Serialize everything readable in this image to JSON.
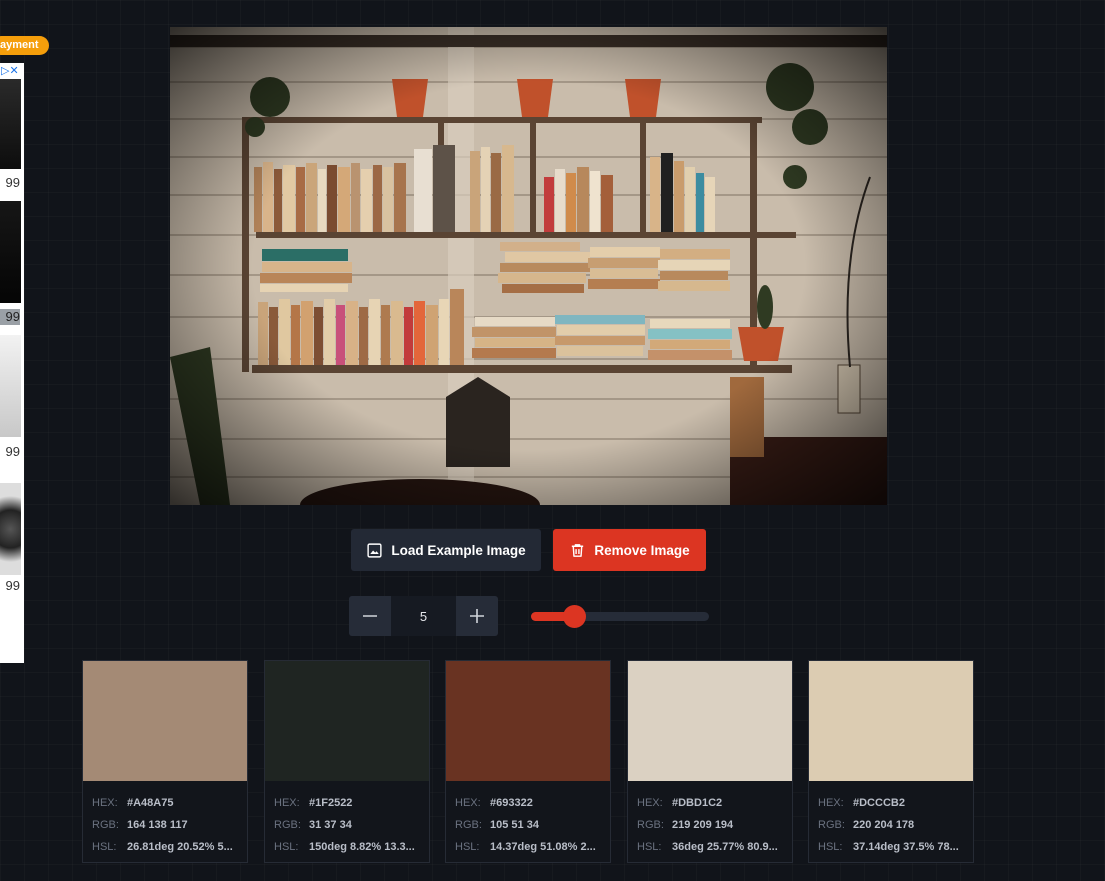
{
  "ad": {
    "badge": "ayment",
    "close_icon": "ad-choices-close",
    "prices": [
      "99",
      "99",
      "99",
      "99"
    ]
  },
  "image": {
    "description_icon": "bookshelf-photo"
  },
  "buttons": {
    "load_label": "Load Example Image",
    "remove_label": "Remove Image"
  },
  "palette_controls": {
    "count": "5",
    "slider_fraction": 0.24
  },
  "labels": {
    "hex": "HEX:",
    "rgb": "RGB:",
    "hsl": "HSL:"
  },
  "palette": [
    {
      "color": "#A48A75",
      "hex": "#A48A75",
      "rgb": "164 138 117",
      "hsl": "26.81deg 20.52% 5..."
    },
    {
      "color": "#1F2522",
      "hex": "#1F2522",
      "rgb": "31 37 34",
      "hsl": "150deg 8.82% 13.3..."
    },
    {
      "color": "#693322",
      "hex": "#693322",
      "rgb": "105 51 34",
      "hsl": "14.37deg 51.08% 2..."
    },
    {
      "color": "#DBD1C2",
      "hex": "#DBD1C2",
      "rgb": "219 209 194",
      "hsl": "36deg 25.77% 80.9..."
    },
    {
      "color": "#DCCCB2",
      "hex": "#DCCCB2",
      "rgb": "220 204 178",
      "hsl": "37.14deg 37.5% 78..."
    }
  ]
}
